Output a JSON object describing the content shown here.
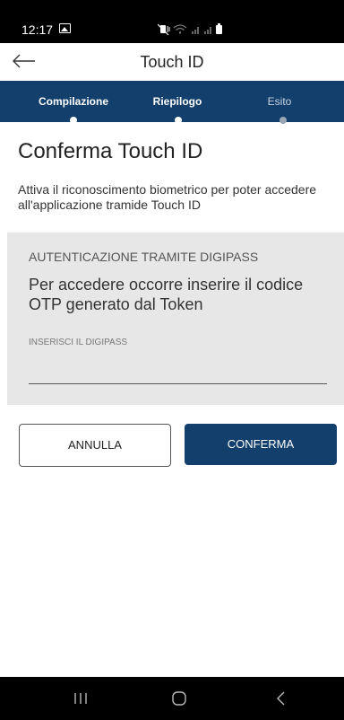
{
  "status_bar": {
    "time": "12:17",
    "icons": [
      "gallery-icon",
      "mute-vibrate-icon",
      "wifi-icon",
      "signal-icon",
      "signal-icon",
      "battery-icon"
    ]
  },
  "app_bar": {
    "title": "Touch ID",
    "back_icon": "back-arrow-icon"
  },
  "stepper": {
    "steps": [
      {
        "label": "Compilazione",
        "state": "completed"
      },
      {
        "label": "Riepilogo",
        "state": "active"
      },
      {
        "label": "Esito",
        "state": "pending"
      }
    ]
  },
  "content": {
    "title": "Conferma Touch ID",
    "description": "Attiva il riconoscimento biometrico per poter accedere all'applicazione tramide Touch ID"
  },
  "otp_card": {
    "label": "AUTENTICAZIONE TRAMITE DIGIPASS",
    "message": "Per accedere occorre inserire il codice OTP generato dal Token",
    "input_label": "INSERISCI IL DIGIPASS",
    "input_value": ""
  },
  "actions": {
    "cancel_label": "ANNULLA",
    "confirm_label": "CONFERMA"
  },
  "nav_bar": {
    "buttons": [
      "recent-apps-icon",
      "home-icon",
      "back-icon"
    ]
  },
  "colors": {
    "primary": "#123f6b",
    "card_background": "#e7e7e7",
    "status_bar": "#000000"
  }
}
